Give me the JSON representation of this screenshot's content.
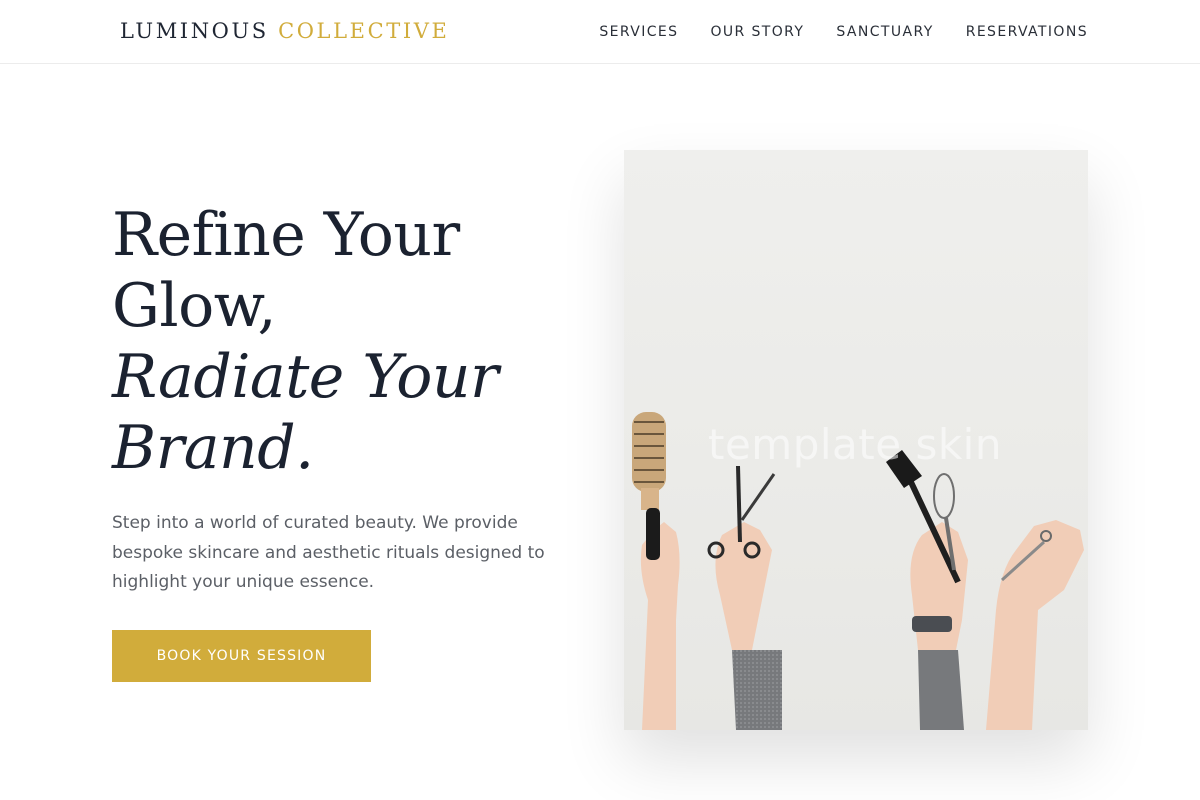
{
  "brand": {
    "name_primary": "LUMINOUS",
    "name_accent": "COLLECTIVE"
  },
  "nav": {
    "items": [
      {
        "label": "SERVICES"
      },
      {
        "label": "OUR STORY"
      },
      {
        "label": "SANCTUARY"
      },
      {
        "label": "RESERVATIONS"
      }
    ]
  },
  "hero": {
    "title_line1": "Refine Your",
    "title_line2": "Glow,",
    "title_line3": "Radiate Your",
    "title_line4": "Brand.",
    "description": "Step into a world of curated beauty. We provide bespoke skincare and aesthetic rituals designed to highlight your unique essence.",
    "cta_label": "BOOK YOUR SESSION",
    "image_watermark": "template skin"
  },
  "colors": {
    "accent": "#d1ac3b",
    "text_dark": "#1f2633",
    "text_muted": "#5b5f66"
  }
}
